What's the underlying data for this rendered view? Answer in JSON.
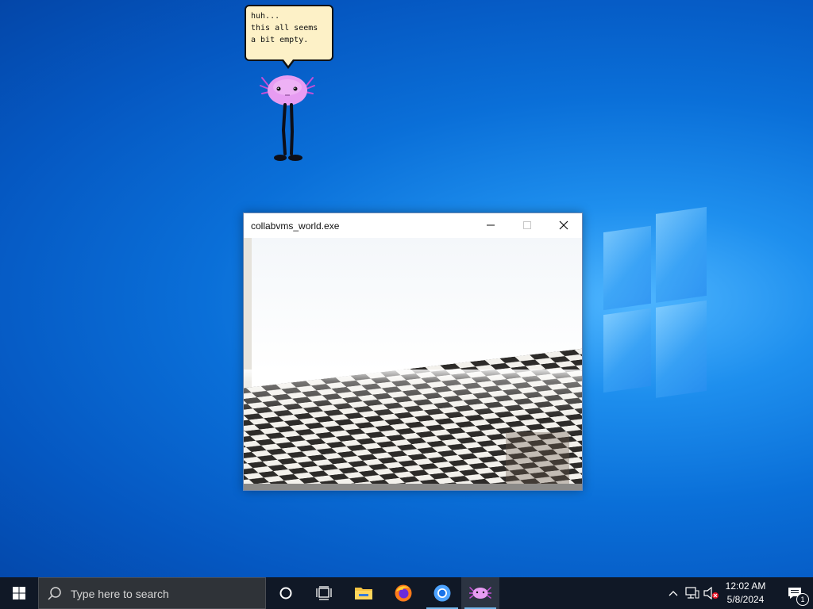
{
  "desktop": {
    "background_color": "#0a6fd8",
    "speech_bubble": {
      "lines": [
        "huh...",
        "this all seems",
        "a bit empty."
      ]
    }
  },
  "app_window": {
    "title": "collabvms_world.exe",
    "controls": {
      "minimize_icon": "minimize-icon",
      "maximize_icon": "maximize-icon",
      "close_icon": "close-icon"
    },
    "viewport": {
      "sky_color": "#ffffff",
      "floor": "black-and-white checkerboard"
    }
  },
  "taskbar": {
    "background_color": "#101826",
    "start_icon": "windows-start-icon",
    "search": {
      "placeholder": "Type here to search",
      "icon": "search-icon"
    },
    "pinned": [
      {
        "name": "cortana",
        "icon": "cortana-circle-icon"
      },
      {
        "name": "task-view",
        "icon": "task-view-icon"
      },
      {
        "name": "file-explorer",
        "icon": "folder-icon"
      },
      {
        "name": "firefox",
        "icon": "firefox-icon"
      },
      {
        "name": "chrome",
        "icon": "chrome-icon"
      },
      {
        "name": "collabvms-world",
        "icon": "axolotl-icon"
      }
    ],
    "tray": {
      "chevron_icon": "chevron-up-icon",
      "network_icon": "network-icon",
      "volume_icon": "volume-muted-icon",
      "time": "12:02 AM",
      "date": "5/8/2024",
      "notifications_icon": "action-center-icon",
      "notification_count": "1"
    }
  }
}
